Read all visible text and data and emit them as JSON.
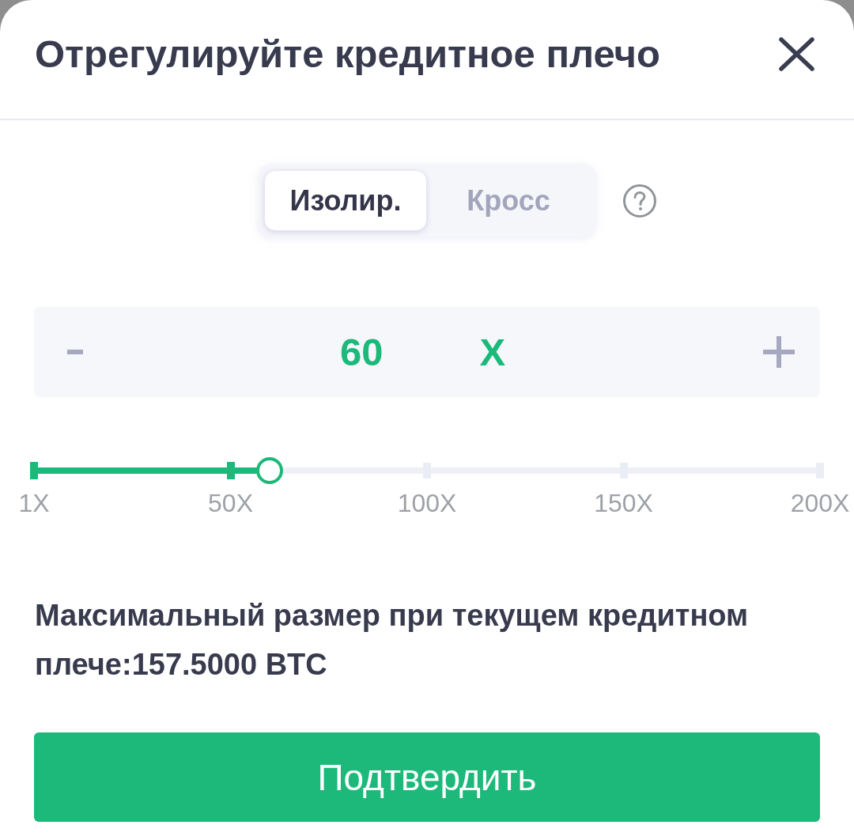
{
  "dialog": {
    "title": "Отрегулируйте кредитное плечо"
  },
  "margin_mode": {
    "tabs": [
      {
        "label": "Изолир.",
        "selected": true
      },
      {
        "label": "Кросс",
        "selected": false
      }
    ]
  },
  "leverage": {
    "value": "60",
    "unit": "X"
  },
  "slider": {
    "level": 0.3,
    "marks": [
      "1X",
      "50X",
      "100X",
      "150X",
      "200X"
    ]
  },
  "max_size": {
    "text": "Максимальный размер при текущем кредитном плече:157.5000 BTC"
  },
  "confirm_button": {
    "label": "Подтвердить"
  }
}
